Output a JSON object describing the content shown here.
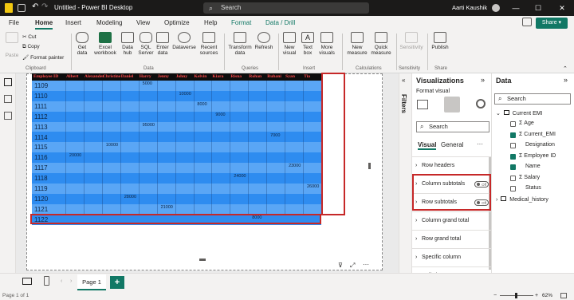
{
  "titlebar": {
    "doc_title": "Untitled - Power BI Desktop",
    "search_placeholder": "Search",
    "user_name": "Aarti Kaushik"
  },
  "tabs": [
    "File",
    "Home",
    "Insert",
    "Modeling",
    "View",
    "Optimize",
    "Help",
    "Format",
    "Data / Drill"
  ],
  "share_label": "Share",
  "ribbon": {
    "paste": "Paste",
    "cut": "Cut",
    "copy": "Copy",
    "format_painter": "Format painter",
    "get_data": [
      "Get",
      "data"
    ],
    "excel": [
      "Excel",
      "workbook"
    ],
    "data_hub": [
      "Data",
      "hub"
    ],
    "sql": [
      "SQL",
      "Server"
    ],
    "enter_data": [
      "Enter",
      "data"
    ],
    "dataverse": "Dataverse",
    "recent_sources": [
      "Recent",
      "sources"
    ],
    "transform": [
      "Transform",
      "data"
    ],
    "refresh": "Refresh",
    "new_visual": [
      "New",
      "visual"
    ],
    "text_box": [
      "Text",
      "box"
    ],
    "more_visuals": [
      "More",
      "visuals"
    ],
    "new_measure": [
      "New",
      "measure"
    ],
    "quick_measure": [
      "Quick",
      "measure"
    ],
    "sensitivity": "Sensitivity",
    "publish": "Publish",
    "groups": {
      "clipboard": "Clipboard",
      "data": "Data",
      "queries": "Queries",
      "insert": "Insert",
      "calculations": "Calculations",
      "sensitivity": "Sensitivity",
      "share": "Share"
    }
  },
  "matrix": {
    "header_first": "Employee ID",
    "columns": [
      "Albert",
      "Alexander",
      "Christine",
      "Daniel",
      "Harry",
      "Jenny",
      "Johny",
      "Kelvin",
      "Kiara",
      "Risna",
      "Rohan",
      "Ruhani",
      "Syan",
      "Tia"
    ],
    "rows": [
      {
        "id": "1109",
        "value": "5000"
      },
      {
        "id": "1110",
        "value": "10000"
      },
      {
        "id": "1111",
        "value": "8000"
      },
      {
        "id": "1112",
        "value": "9000"
      },
      {
        "id": "1113",
        "value": "95000"
      },
      {
        "id": "1114",
        "value": "7000"
      },
      {
        "id": "1115",
        "value": "10000"
      },
      {
        "id": "1116",
        "value": "20000"
      },
      {
        "id": "1117",
        "value": "23000"
      },
      {
        "id": "1118",
        "value": "24000"
      },
      {
        "id": "1119",
        "value": "26000"
      },
      {
        "id": "1120",
        "value": "28000"
      },
      {
        "id": "1121",
        "value": "21000"
      },
      {
        "id": "1122",
        "value": "8000"
      }
    ]
  },
  "filters_label": "Filters",
  "viz_pane": {
    "title": "Visualizations",
    "subtitle": "Format visual",
    "search_placeholder": "Search",
    "tab_visual": "Visual",
    "tab_general": "General",
    "more": "···",
    "sections": [
      "Row headers",
      "Column subtotals",
      "Row subtotals",
      "Column grand total",
      "Row grand total",
      "Specific column",
      "Cell elements"
    ],
    "toggle_off": "Off"
  },
  "data_pane": {
    "title": "Data",
    "search_placeholder": "Search",
    "table1": "Current EMI",
    "fields": [
      {
        "name": "Age",
        "checked": false,
        "sigma": true
      },
      {
        "name": "Current_EMI",
        "checked": true,
        "sigma": true
      },
      {
        "name": "Designation",
        "checked": false,
        "sigma": false
      },
      {
        "name": "Employee ID",
        "checked": true,
        "sigma": true
      },
      {
        "name": "Name",
        "checked": true,
        "sigma": false
      },
      {
        "name": "Salary",
        "checked": false,
        "sigma": true
      },
      {
        "name": "Status",
        "checked": false,
        "sigma": false
      }
    ],
    "table2": "Medical_history"
  },
  "page_tab": "Page 1",
  "add_page": "+",
  "status": {
    "page_info": "Page 1 of 1",
    "zoom": "62%"
  },
  "colors": {
    "accent": "#117865",
    "matrix_blue": "#2e8cf0",
    "matrix_light": "#5aa6f5",
    "highlight": "#c62828"
  }
}
